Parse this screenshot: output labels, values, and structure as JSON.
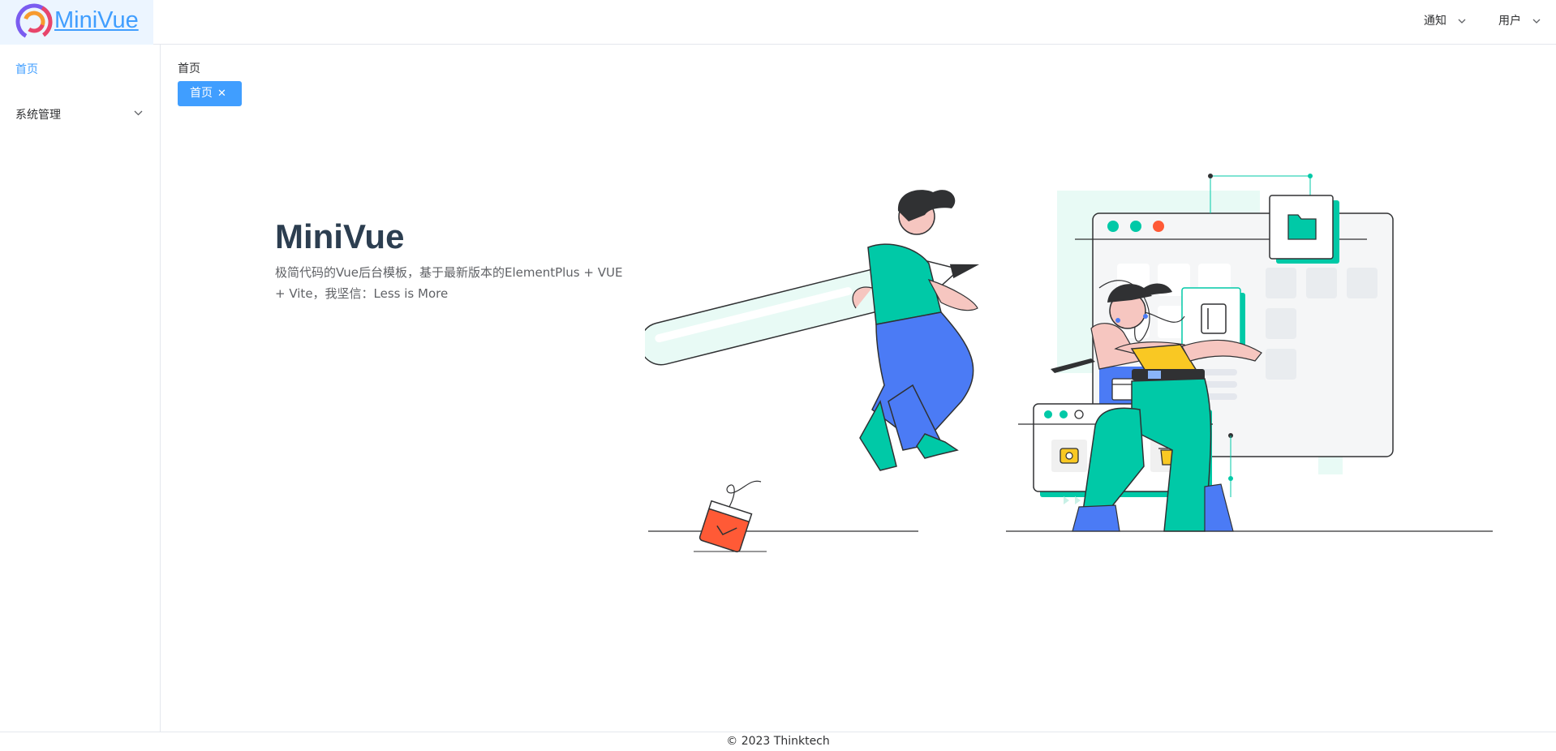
{
  "app": {
    "logo_text": "MiniVue"
  },
  "header": {
    "notify_label": "通知",
    "user_label": "用户"
  },
  "sidebar": {
    "items": [
      {
        "label": "首页"
      },
      {
        "label": "系统管理"
      }
    ]
  },
  "breadcrumb": {
    "current": "首页"
  },
  "tags": {
    "active_label": "首页",
    "close_glyph": "✕"
  },
  "hero": {
    "title": "MiniVue",
    "description": "极简代码的Vue后台模板，基于最新版本的ElementPlus + VUE + Vite，我坚信：Less is More"
  },
  "footer": {
    "copyright": "© 2023 Thinktech"
  },
  "colors": {
    "accent": "#409eff",
    "teal": "#00c9a7",
    "red": "#ff5a36",
    "blue": "#4b7bf5",
    "yellow": "#f9c823"
  },
  "icons": [
    "logo-icon",
    "chevron-down-icon",
    "close-icon",
    "folder-icon",
    "notebook-icon",
    "calendar-icon",
    "camera-icon",
    "star-icon",
    "trash-icon"
  ]
}
